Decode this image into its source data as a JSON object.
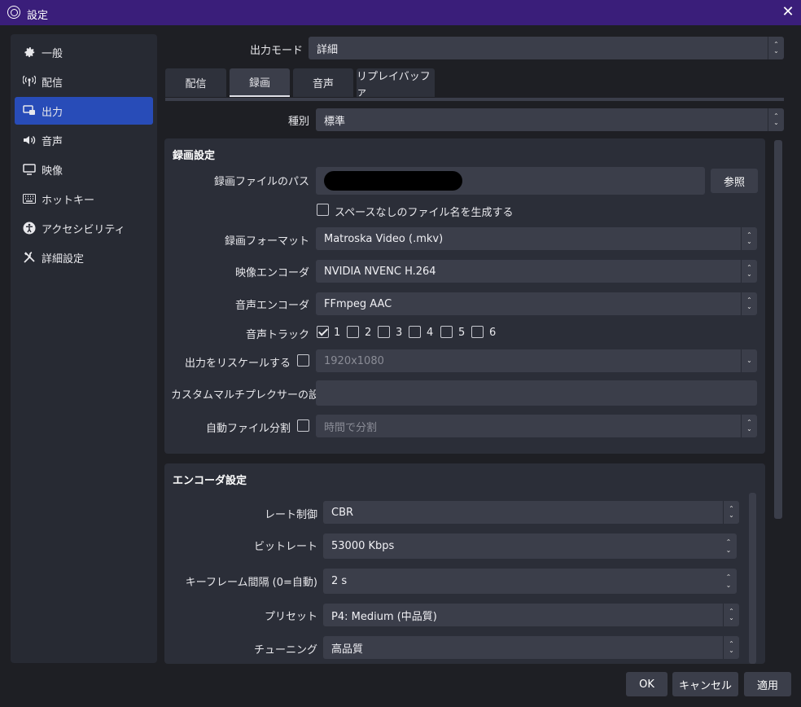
{
  "window": {
    "title": "設定"
  },
  "sidebar": {
    "items": [
      {
        "label": "一般",
        "icon": "gear-icon"
      },
      {
        "label": "配信",
        "icon": "broadcast-icon"
      },
      {
        "label": "出力",
        "icon": "output-icon"
      },
      {
        "label": "音声",
        "icon": "speaker-icon"
      },
      {
        "label": "映像",
        "icon": "monitor-icon"
      },
      {
        "label": "ホットキー",
        "icon": "keyboard-icon"
      },
      {
        "label": "アクセシビリティ",
        "icon": "accessibility-icon"
      },
      {
        "label": "詳細設定",
        "icon": "tools-icon"
      }
    ],
    "active_index": 2
  },
  "output_mode": {
    "label": "出力モード",
    "value": "詳細"
  },
  "tabs": [
    {
      "label": "配信"
    },
    {
      "label": "録画"
    },
    {
      "label": "音声"
    },
    {
      "label": "リプレイバッファ"
    }
  ],
  "active_tab": 1,
  "type": {
    "label": "種別",
    "value": "標準"
  },
  "recording": {
    "title": "録画設定",
    "path_label": "録画ファイルのパス",
    "browse_label": "参照",
    "nospace_label": "スペースなしのファイル名を生成する",
    "format_label": "録画フォーマット",
    "format_value": "Matroska Video (.mkv)",
    "video_encoder_label": "映像エンコーダ",
    "video_encoder_value": "NVIDIA NVENC H.264",
    "audio_encoder_label": "音声エンコーダ",
    "audio_encoder_value": "FFmpeg AAC",
    "tracks_label": "音声トラック",
    "tracks": [
      {
        "n": "1",
        "checked": true
      },
      {
        "n": "2",
        "checked": false
      },
      {
        "n": "3",
        "checked": false
      },
      {
        "n": "4",
        "checked": false
      },
      {
        "n": "5",
        "checked": false
      },
      {
        "n": "6",
        "checked": false
      }
    ],
    "rescale_label": "出力をリスケールする",
    "rescale_value": "1920x1080",
    "muxer_label": "カスタムマルチプレクサーの設定",
    "muxer_value": "",
    "split_label": "自動ファイル分割",
    "split_value": "時間で分割"
  },
  "encoder": {
    "title": "エンコーダ設定",
    "rate_label": "レート制御",
    "rate_value": "CBR",
    "bitrate_label": "ビットレート",
    "bitrate_value": "53000 Kbps",
    "keyframe_label": "キーフレーム間隔 (0=自動)",
    "keyframe_value": "2 s",
    "preset_label": "プリセット",
    "preset_value": "P4: Medium (中品質)",
    "tuning_label": "チューニング",
    "tuning_value": "高品質"
  },
  "buttons": {
    "ok": "OK",
    "cancel": "キャンセル",
    "apply": "適用"
  },
  "colors": {
    "titlebar": "#3a1e7a",
    "accent": "#284cb8",
    "background": "#1e1f24"
  }
}
